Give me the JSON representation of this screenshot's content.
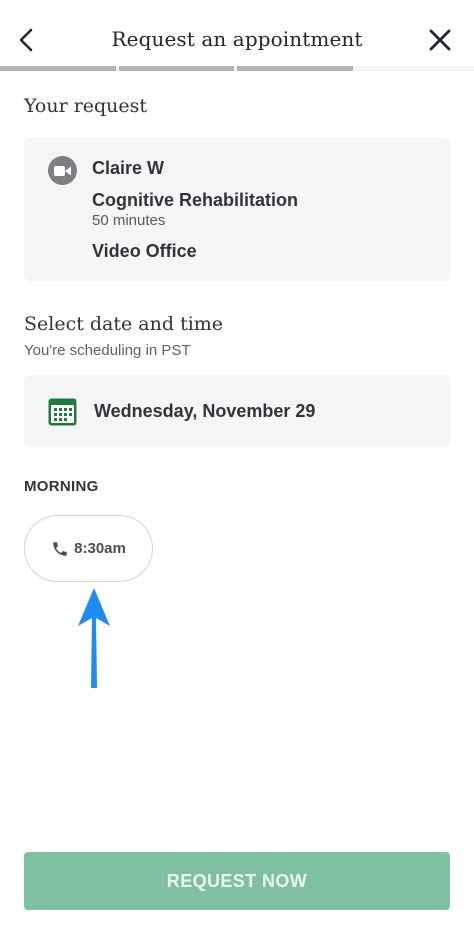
{
  "header": {
    "title": "Request an appointment",
    "back_icon": "chevron-left-icon",
    "close_icon": "close-icon"
  },
  "progress": {
    "total_steps": 4,
    "completed_steps": 3
  },
  "request_section": {
    "heading": "Your request",
    "provider": "Claire W",
    "service": "Cognitive Rehabilitation",
    "duration": "50 minutes",
    "location": "Video Office",
    "icon": "video-camera-icon"
  },
  "datetime_section": {
    "heading": "Select date and time",
    "timezone_note": "You're scheduling in PST",
    "selected_date": "Wednesday, November 29",
    "icon": "calendar-icon"
  },
  "slots": {
    "period_label": "MORNING",
    "times": [
      "8:30am"
    ],
    "icon": "phone-icon"
  },
  "annotation": {
    "icon": "arrow-up-icon",
    "color": "#1e8cf0"
  },
  "footer": {
    "request_label": "REQUEST NOW",
    "button_color": "#7fc19e"
  }
}
